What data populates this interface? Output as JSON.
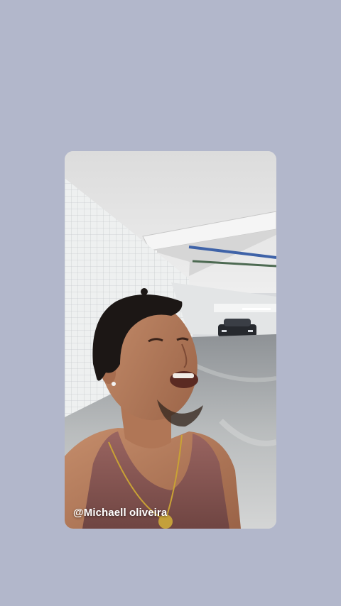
{
  "story": {
    "caption": "@Michaell oliveira"
  },
  "colors": {
    "page_background": "#b2b7cb",
    "caption_text": "#ffffff"
  }
}
